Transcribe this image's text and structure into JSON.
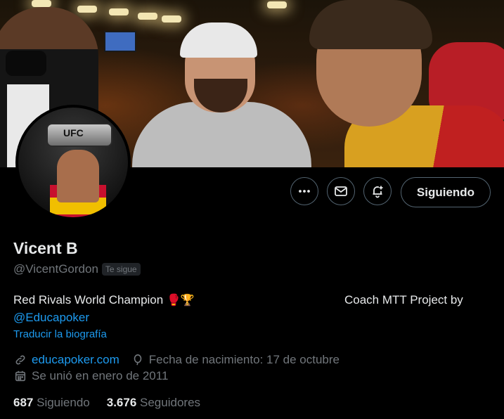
{
  "profile": {
    "name": "Vicent B",
    "handle": "@VicentGordon",
    "follows_you": "Te sigue",
    "bio": {
      "line1": "Red Rivals World Champion",
      "emoji1": "🥊",
      "emoji2": "🏆",
      "coach": "Coach MTT Project by",
      "mention": "@Educapoker"
    },
    "translate": "Traducir la biografía",
    "website": "educapoker.com",
    "birthday": "Fecha de nacimiento: 17 de octubre",
    "joined": "Se unió en enero de 2011",
    "following_count": "687",
    "following_label": "Siguiendo",
    "followers_count": "3.676",
    "followers_label": "Seguidores"
  },
  "actions": {
    "more_icon": "more-icon",
    "message_icon": "mail-icon",
    "notify_icon": "bell-plus-icon",
    "follow_label": "Siguiendo"
  },
  "avatar": {
    "belt_text": "UFC"
  },
  "colors": {
    "background": "#000000",
    "text": "#e7e9ea",
    "muted": "#71767b",
    "link": "#1d9bf0",
    "border": "#536471"
  }
}
